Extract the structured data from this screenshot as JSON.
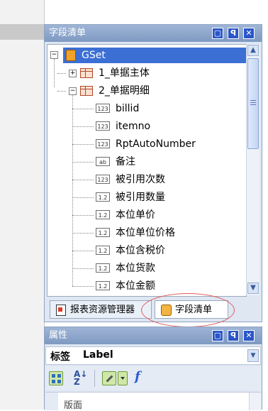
{
  "field_panel": {
    "title": "字段清单",
    "buttons": {
      "maximize": "▢",
      "pin": "ꟼ",
      "close": "✕"
    },
    "root": {
      "label": "GSet",
      "expander": "−"
    },
    "groups": [
      {
        "label": "1_单据主体",
        "expander": "+"
      },
      {
        "label": "2_单据明细",
        "expander": "−"
      }
    ],
    "fields": [
      {
        "type": "123",
        "label": "billid"
      },
      {
        "type": "123",
        "label": "itemno"
      },
      {
        "type": "123",
        "label": "RptAutoNumber"
      },
      {
        "type": "ab",
        "label": "备注"
      },
      {
        "type": "123",
        "label": "被引用次数"
      },
      {
        "type": "1.2",
        "label": "被引用数量"
      },
      {
        "type": "1.2",
        "label": "本位单价"
      },
      {
        "type": "1.2",
        "label": "本位单位价格"
      },
      {
        "type": "1.2",
        "label": "本位含税价"
      },
      {
        "type": "1.2",
        "label": "本位货款"
      },
      {
        "type": "1.2",
        "label": "本位金额"
      }
    ],
    "tabs": [
      {
        "label": "报表资源管理器"
      },
      {
        "label": "字段清单"
      }
    ]
  },
  "props_panel": {
    "title": "属性",
    "object_label": "标签",
    "object_value": "Label",
    "section": "版面"
  },
  "colors": {
    "title_bar": "#8ea6cc",
    "selection": "#3b6fd4",
    "highlight_ellipse": "#e05a5a"
  }
}
